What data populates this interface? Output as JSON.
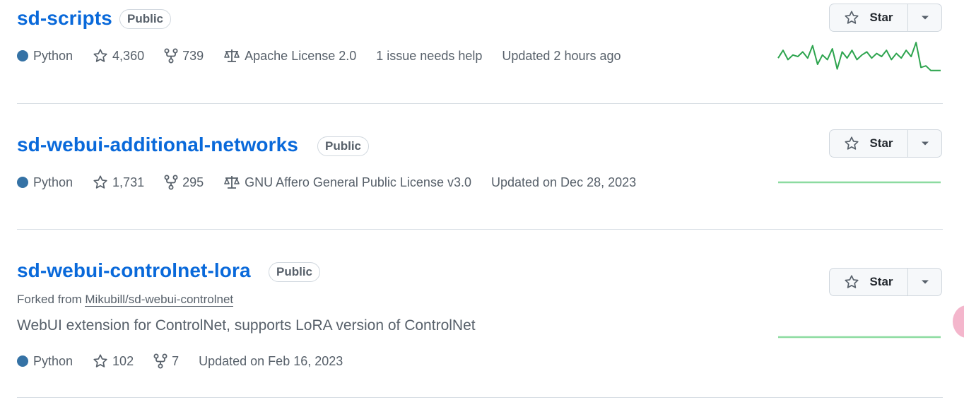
{
  "repos": [
    {
      "name": "sd-scripts",
      "visibility": "Public",
      "language": "Python",
      "stars": "4,360",
      "forks": "739",
      "license": "Apache License 2.0",
      "issues": "1 issue needs help",
      "updated": "Updated 2 hours ago",
      "star_label": "Star",
      "sparkline_color": "#2da44e",
      "activity": [
        0.55,
        0.3,
        0.6,
        0.45,
        0.5,
        0.35,
        0.55,
        0.15,
        0.75,
        0.45,
        0.6,
        0.25,
        0.9,
        0.35,
        0.55,
        0.3,
        0.6,
        0.45,
        0.35,
        0.55,
        0.4,
        0.5,
        0.3,
        0.6,
        0.4,
        0.55,
        0.3,
        0.5,
        0.05,
        0.85,
        0.8,
        0.95,
        0.95,
        0.95
      ]
    },
    {
      "name": "sd-webui-additional-networks",
      "visibility": "Public",
      "language": "Python",
      "stars": "1,731",
      "forks": "295",
      "license": "GNU Affero General Public License v3.0",
      "updated": "Updated on Dec 28, 2023",
      "star_label": "Star",
      "sparkline_color": "#8cdba0"
    },
    {
      "name": "sd-webui-controlnet-lora",
      "visibility": "Public",
      "forked_prefix": "Forked from",
      "forked_from": "Mikubill/sd-webui-controlnet",
      "description": "WebUI extension for ControlNet, supports LoRA version of ControlNet",
      "language": "Python",
      "stars": "102",
      "forks": "7",
      "updated": "Updated on Feb 16, 2023",
      "star_label": "Star",
      "sparkline_color": "#8cdba0"
    }
  ],
  "colors": {
    "link": "#0969da",
    "muted": "#57606a",
    "python": "#3572A5"
  }
}
